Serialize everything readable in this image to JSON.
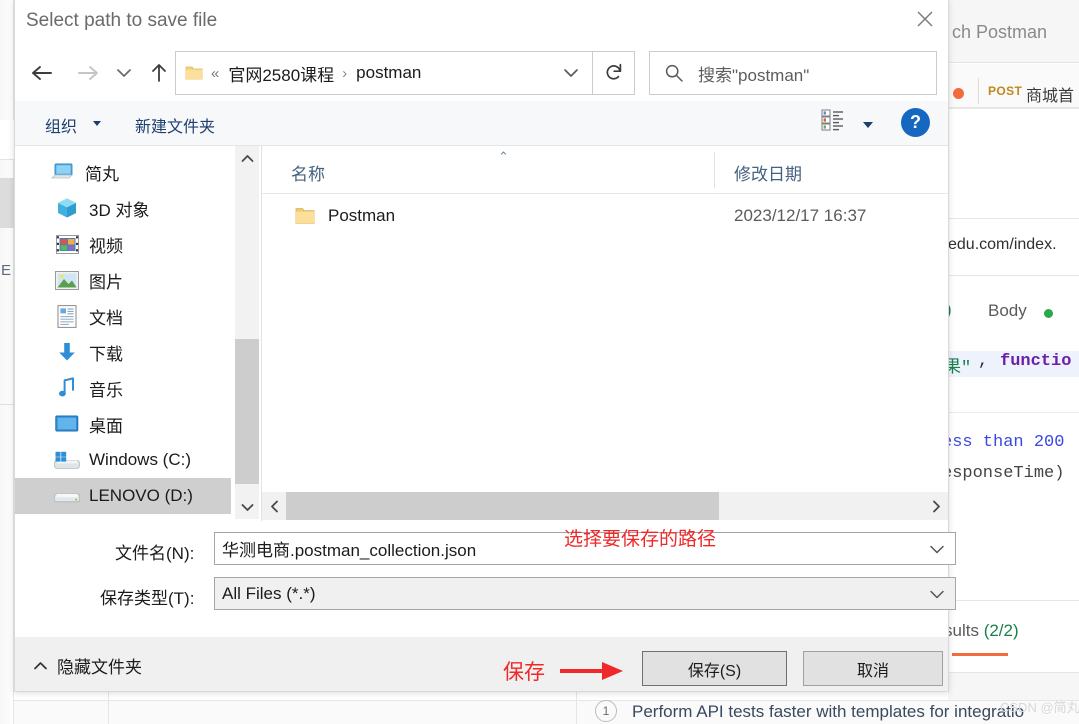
{
  "dialog": {
    "title": "Select path to save file",
    "close_label": "×",
    "nav": {
      "back": "←",
      "forward": "→",
      "recent": "˅",
      "up": "↑",
      "refresh": "↻"
    },
    "address": {
      "chevron": "«",
      "segment_1": "官网2580课程",
      "separator": "›",
      "segment_2": "postman",
      "dropdown": "˅"
    },
    "search": {
      "placeholder": "搜索\"postman\"",
      "icon": "search-icon"
    },
    "commandbar": {
      "organize": "组织",
      "new_folder": "新建文件夹",
      "view_icon": "view-layout-icon",
      "help": "?"
    },
    "nav_pane": {
      "items": [
        {
          "label": "简丸",
          "icon": "computer-icon",
          "selected": false,
          "root": true
        },
        {
          "label": "3D 对象",
          "icon": "3d-objects-icon",
          "selected": false,
          "root": false
        },
        {
          "label": "视频",
          "icon": "videos-icon",
          "selected": false,
          "root": false
        },
        {
          "label": "图片",
          "icon": "pictures-icon",
          "selected": false,
          "root": false
        },
        {
          "label": "文档",
          "icon": "documents-icon",
          "selected": false,
          "root": false
        },
        {
          "label": "下载",
          "icon": "downloads-icon",
          "selected": false,
          "root": false
        },
        {
          "label": "音乐",
          "icon": "music-icon",
          "selected": false,
          "root": false
        },
        {
          "label": "桌面",
          "icon": "desktop-icon",
          "selected": false,
          "root": false
        },
        {
          "label": "Windows (C:)",
          "icon": "windows-drive-icon",
          "selected": false,
          "root": false
        },
        {
          "label": "LENOVO (D:)",
          "icon": "drive-icon",
          "selected": true,
          "root": false
        }
      ]
    },
    "file_list": {
      "columns": [
        "名称",
        "修改日期"
      ],
      "sort_indicator": "⌃",
      "rows": [
        {
          "name": "Postman",
          "date": "2023/12/17 16:37",
          "icon": "folder-icon"
        }
      ]
    },
    "form": {
      "filename_label": "文件名(N):",
      "filename_value": "华测电商.postman_collection.json",
      "savetype_label": "保存类型(T):",
      "savetype_value": "All Files (*.*)",
      "dropdown_caret": "˅"
    },
    "footer": {
      "hide_folders": "隐藏文件夹",
      "hide_folders_caret": "∧",
      "save_button": "保存(S)",
      "cancel_button": "取消"
    },
    "scrollbars": {
      "up": "⌃",
      "down": "⌄",
      "left": "‹",
      "right": "›"
    }
  },
  "annotations": {
    "path_note": "选择要保存的路径",
    "save_note": "保存",
    "color": "#ef2929"
  },
  "background": {
    "search_label": "ch Postman",
    "tab_method": "POST",
    "tab_name": "商城首",
    "url_fragment": "edu.com/index.",
    "paren": ")",
    "body_tab": "Body",
    "code_cn": "果\"",
    "code_comma": ", ",
    "code_fn": "functio",
    "code_line2": "ess than 200",
    "code_line3": "esponseTime)",
    "results_label": "sults ",
    "results_count": "(2/2)",
    "footer_num": "1",
    "footer_text": "Perform API tests faster with templates for integratio",
    "watermark": "CSDN @简丸****",
    "rail_letter": "E"
  }
}
